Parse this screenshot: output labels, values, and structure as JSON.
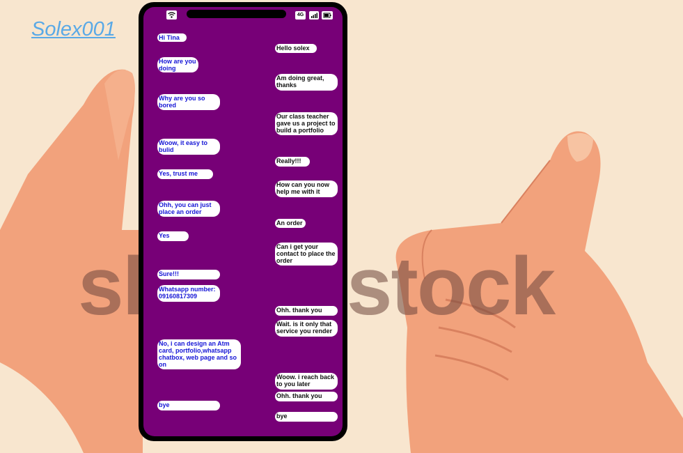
{
  "brand": {
    "title": "Solex001"
  },
  "watermark": {
    "text": "shutterstock"
  },
  "status": {
    "network": "4G"
  },
  "messages": [
    {
      "side": "left",
      "text": "Hi Tina"
    },
    {
      "side": "right",
      "text": "Hello solex"
    },
    {
      "side": "left",
      "text": "How are you doing"
    },
    {
      "side": "right",
      "text": "Am doing great, thanks"
    },
    {
      "side": "left",
      "text": "Why are you so bored"
    },
    {
      "side": "right",
      "text": "Our class teacher gave us a project to build a portfolio"
    },
    {
      "side": "left",
      "text": "Woow, it easy to bulid"
    },
    {
      "side": "right",
      "text": "Really!!!"
    },
    {
      "side": "left",
      "text": "Yes, trust me"
    },
    {
      "side": "right",
      "text": "How can you now help me with it"
    },
    {
      "side": "left",
      "text": "Ohh, you can just place an order"
    },
    {
      "side": "right",
      "text": "An order"
    },
    {
      "side": "left",
      "text": "Yes"
    },
    {
      "side": "right",
      "text": "Can i get your contact to place the order"
    },
    {
      "side": "left",
      "text": "Sure!!!"
    },
    {
      "side": "left",
      "text": "Whatsapp number: 09160817309"
    },
    {
      "side": "right",
      "text": "Ohh. thank you"
    },
    {
      "side": "right",
      "text": "Wait. is it only that service you render"
    },
    {
      "side": "left",
      "text": "No, i can design an Atm card, portfolio,whatsapp chatbox, web page and so on"
    },
    {
      "side": "right",
      "text": "Woow. i reach back to you later"
    },
    {
      "side": "right",
      "text": "Ohh. thank you"
    },
    {
      "side": "left",
      "text": "bye"
    },
    {
      "side": "right",
      "text": "bye"
    }
  ]
}
